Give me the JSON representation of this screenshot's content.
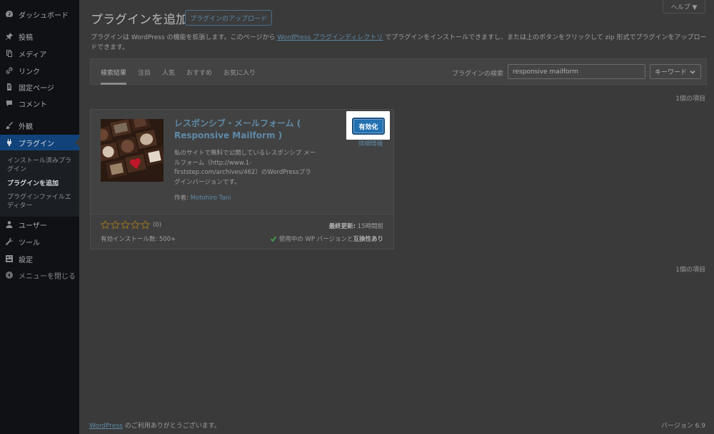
{
  "sidebar": {
    "items": [
      {
        "label": "ダッシュボード",
        "icon": "dashboard-icon"
      },
      {
        "label": "投稿",
        "icon": "pin-icon"
      },
      {
        "label": "メディア",
        "icon": "media-icon"
      },
      {
        "label": "リンク",
        "icon": "link-icon"
      },
      {
        "label": "固定ページ",
        "icon": "page-icon"
      },
      {
        "label": "コメント",
        "icon": "comment-icon"
      },
      {
        "label": "外観",
        "icon": "brush-icon"
      },
      {
        "label": "プラグイン",
        "icon": "plugin-icon"
      },
      {
        "label": "ユーザー",
        "icon": "user-icon"
      },
      {
        "label": "ツール",
        "icon": "wrench-icon"
      },
      {
        "label": "設定",
        "icon": "settings-icon"
      },
      {
        "label": "メニューを閉じる",
        "icon": "collapse-icon"
      }
    ],
    "submenu": [
      {
        "label": "インストール済みプラグイン"
      },
      {
        "label": "プラグインを追加"
      },
      {
        "label": "プラグインファイルエディター"
      }
    ]
  },
  "header": {
    "title": "プラグインを追加",
    "upload_label": "プラグインのアップロード",
    "help_label": "ヘルプ ▼"
  },
  "description": {
    "before": "プラグインは WordPress の機能を拡張します。このページから ",
    "link": "WordPress プラグインディレクトリ",
    "after": " でプラグインをインストールできますし、または上のボタンをクリックして zip 形式でプラグインをアップロードできます。"
  },
  "filter": {
    "tabs": [
      {
        "label": "検索結果"
      },
      {
        "label": "注目"
      },
      {
        "label": "人気"
      },
      {
        "label": "おすすめ"
      },
      {
        "label": "お気に入り"
      }
    ],
    "search_label": "プラグインの検索",
    "search_value": "responsive mailform",
    "type_value": "キーワード"
  },
  "results": {
    "count_top": "1個の項目",
    "count_bottom": "1個の項目"
  },
  "plugin": {
    "name": "レスポンシブ・メールフォーム ( Responsive Mailform )",
    "description": "私のサイトで無料で公開しているレスポンシブ メールフォーム（http://www.1-firststep.com/archives/462）のWordPressプラグインバージョンです。",
    "author_label": "作者: ",
    "author_name": "Motohiro Tani",
    "activate_label": "有効化",
    "details_label": "詳細情報",
    "rating_count": "(0)",
    "installs": "有効インストール数: 500+",
    "updated_label": "最終更新:",
    "updated_value": " 15時間前",
    "compat_before": "使用中の WP バージョンと",
    "compat_bold": "互換性あり",
    "rating": 0
  },
  "footer": {
    "link": "WordPress",
    "text": " のご利用ありがとうございます。",
    "version": "バージョン 6.9"
  },
  "colors": {
    "accent": "#2271b1",
    "sidebar_active": "#11437a",
    "link": "#5e8aa8"
  }
}
